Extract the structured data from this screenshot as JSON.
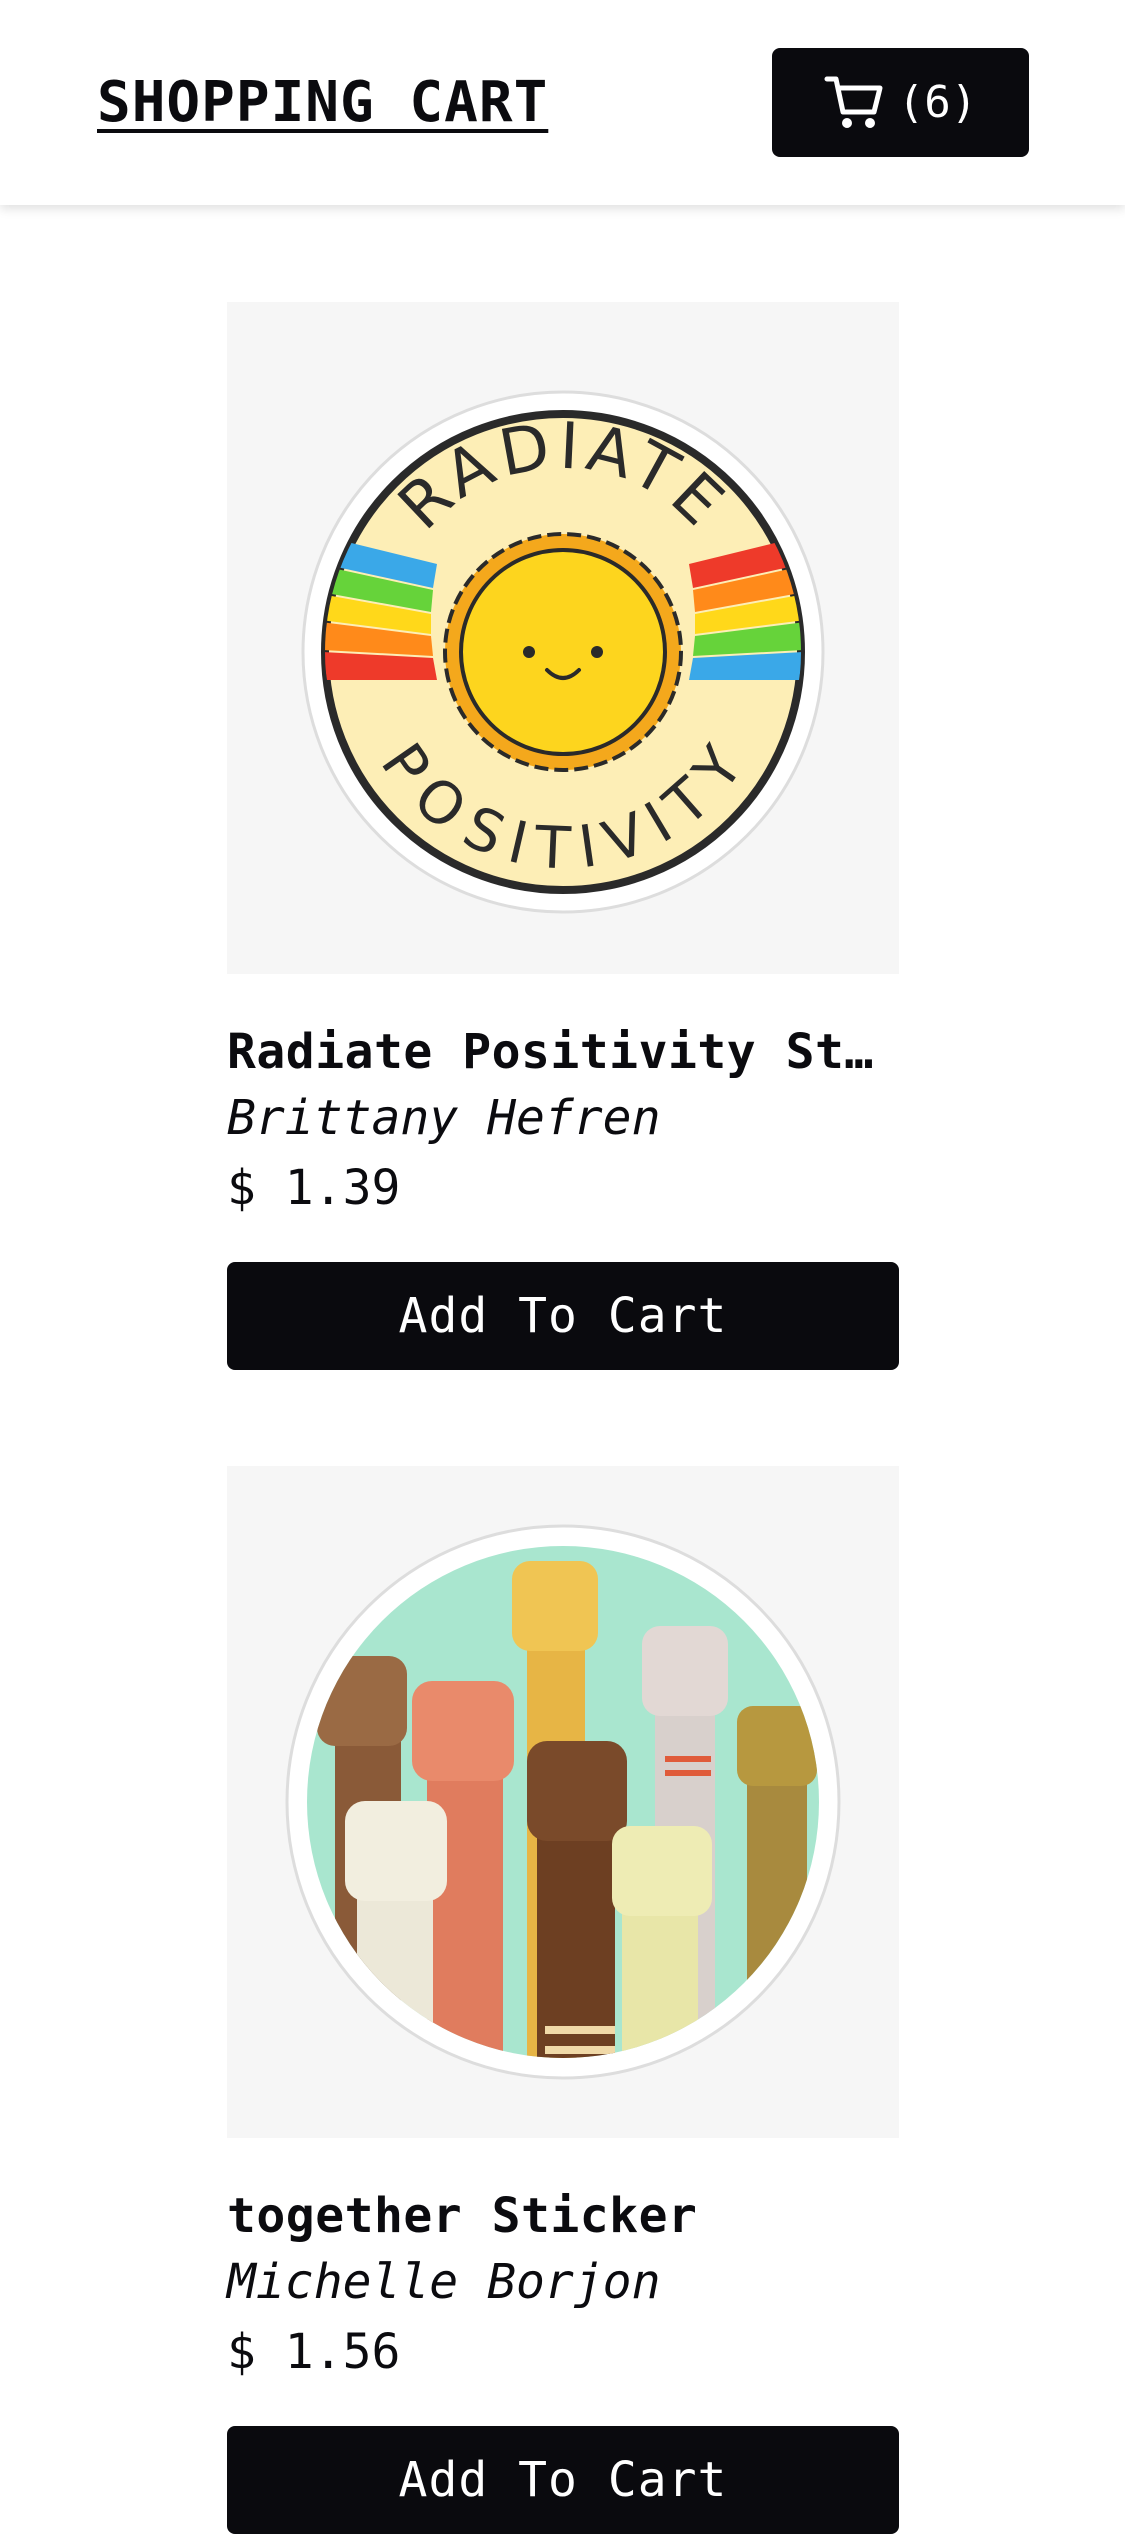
{
  "header": {
    "title": "SHOPPING CART",
    "cart_count_label": "(6)",
    "cart_icon": "cart-icon"
  },
  "products": [
    {
      "name": "Radiate Positivity Sticker",
      "artist": "Brittany Hefren",
      "price": "$ 1.39",
      "button_label": "Add To Cart",
      "image_text_top": "RADIATE",
      "image_text_bottom": "POSITIVITY"
    },
    {
      "name": "together Sticker",
      "artist": "Michelle Borjon",
      "price": "$ 1.56",
      "button_label": "Add To Cart"
    }
  ],
  "colors": {
    "primary": "#0a0a0e",
    "image_background": "#f6f6f6",
    "text": "#0b0b0f"
  }
}
